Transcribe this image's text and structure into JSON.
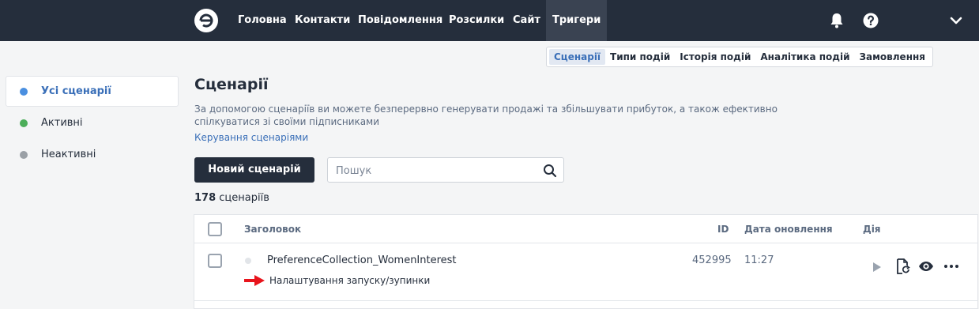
{
  "topbar": {
    "nav": [
      {
        "label": "Головна"
      },
      {
        "label": "Контакти"
      },
      {
        "label": "Повідомлення"
      },
      {
        "label": "Розсилки"
      },
      {
        "label": "Сайт"
      },
      {
        "label": "Тригери",
        "active": true
      }
    ],
    "icons": [
      "logo-icon",
      "bell-icon",
      "help-icon",
      "chevron-down-icon"
    ]
  },
  "subnav": [
    {
      "label": "Сценарії",
      "active": true
    },
    {
      "label": "Типи подій"
    },
    {
      "label": "Історія подій"
    },
    {
      "label": "Аналітика подій"
    },
    {
      "label": "Замовлення"
    }
  ],
  "sidebar": {
    "items": [
      {
        "label": "Усі сценарії",
        "color": "#4a8fe0",
        "active": true
      },
      {
        "label": "Активні",
        "color": "#4cae5a"
      },
      {
        "label": "Неактивні",
        "color": "#9aa0a6"
      }
    ]
  },
  "main": {
    "title": "Сценарії",
    "description": "За допомогою сценаріїв ви можете безперервно генерувати продажі та збільшувати прибуток, а також ефективно спілкуватися зі своїми підписниками",
    "manage_link": "Керування сценаріями",
    "new_button": "Новий сценарій",
    "search_placeholder": "Пошук",
    "count_number": "178",
    "count_label": "сценаріїв"
  },
  "table": {
    "columns": {
      "title": "Заголовок",
      "id": "ID",
      "updated": "Дата оновлення",
      "action": "Дія"
    },
    "rows": [
      {
        "title": "PreferenceCollection_WomenInterest",
        "id": "452995",
        "updated": "11:27",
        "note": "Налаштування запуску/зупинки"
      }
    ]
  },
  "colors": {
    "topbar": "#252e3c",
    "accent": "#3a6fb8",
    "arrow": "#e8141c"
  }
}
